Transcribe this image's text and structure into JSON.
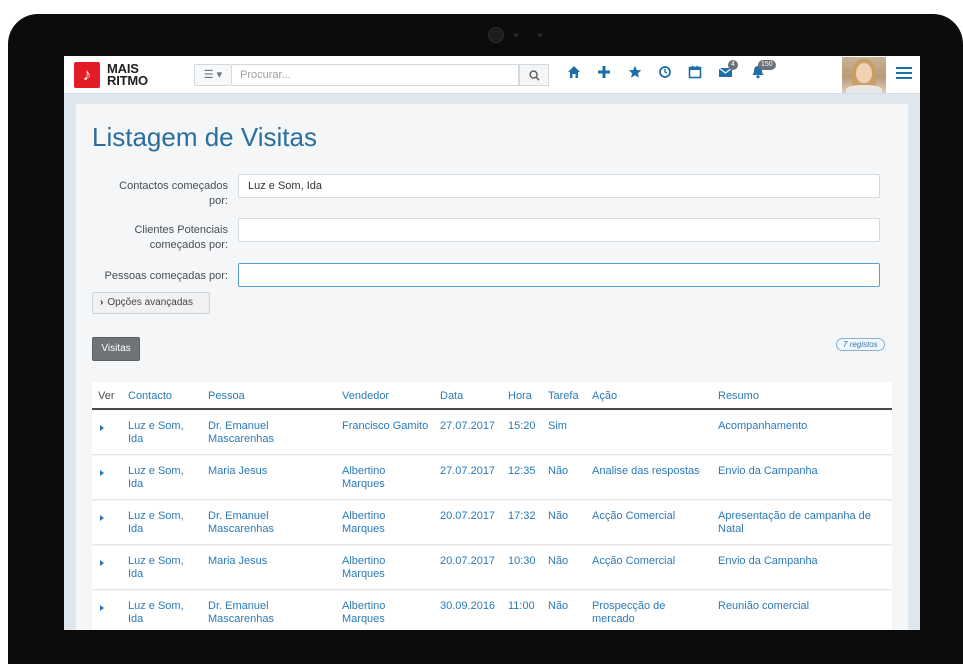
{
  "app": {
    "logo_line1": "MAIS",
    "logo_line2": "RITMO"
  },
  "search": {
    "placeholder": "Procurar..."
  },
  "nav": {
    "messages_badge": "4",
    "notifications_badge": "150"
  },
  "page": {
    "title": "Listagem de Visitas"
  },
  "filters": {
    "contactos_label": "Contactos começados por:",
    "contactos_value": "Luz e Som, Ida",
    "clientes_label": "Clientes Potenciais começados por:",
    "clientes_value": "",
    "pessoas_label": "Pessoas começadas por:",
    "pessoas_value": ""
  },
  "buttons": {
    "advanced": "Opções avançadas",
    "visitas": "Visitas"
  },
  "records_badge": "7 registos",
  "table": {
    "columns": [
      "Ver",
      "Contacto",
      "Pessoa",
      "Vendedor",
      "Data",
      "Hora",
      "Tarefa",
      "Ação",
      "Resumo"
    ],
    "rows": [
      {
        "contacto": "Luz e Som, Ida",
        "pessoa": "Dr. Emanuel Mascarenhas",
        "vendedor": "Francisco Gamito",
        "data": "27.07.2017",
        "hora": "15:20",
        "tarefa": "Sim",
        "acao": "",
        "resumo": "Acompanhamento"
      },
      {
        "contacto": "Luz e Som, Ida",
        "pessoa": "Maria Jesus",
        "vendedor": "Albertino Marques",
        "data": "27.07.2017",
        "hora": "12:35",
        "tarefa": "Não",
        "acao": "Analise das respostas",
        "resumo": "Envio da Campanha"
      },
      {
        "contacto": "Luz e Som, Ida",
        "pessoa": "Dr. Emanuel Mascarenhas",
        "vendedor": "Albertino Marques",
        "data": "20.07.2017",
        "hora": "17:32",
        "tarefa": "Não",
        "acao": "Acção Comercial",
        "resumo": "Apresentação de campanha de Natal"
      },
      {
        "contacto": "Luz e Som, Ida",
        "pessoa": "Maria Jesus",
        "vendedor": "Albertino Marques",
        "data": "20.07.2017",
        "hora": "10:30",
        "tarefa": "Não",
        "acao": "Acção Comercial",
        "resumo": "Envio da Campanha"
      },
      {
        "contacto": "Luz e Som, Ida",
        "pessoa": "Dr. Emanuel Mascarenhas",
        "vendedor": "Albertino Marques",
        "data": "30.09.2016",
        "hora": "11:00",
        "tarefa": "Não",
        "acao": "Prospecção de mercado",
        "resumo": "Reunião comercial"
      }
    ]
  },
  "colors": {
    "accent": "#2a7ab8",
    "brand": "#e31d25",
    "frame": "#0c0c0c"
  }
}
